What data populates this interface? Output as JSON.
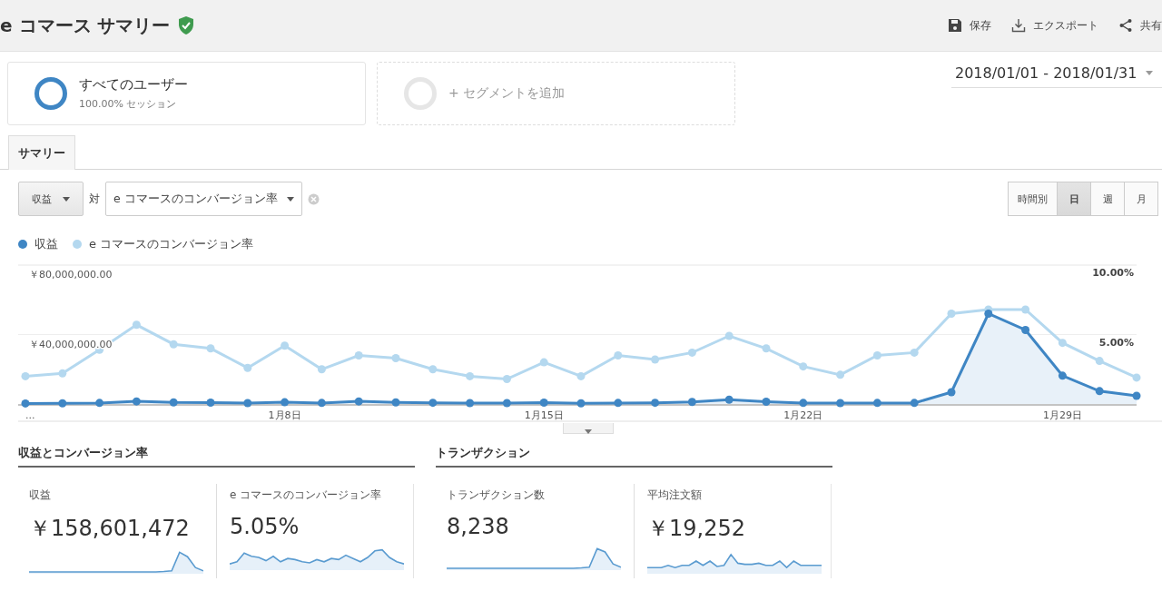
{
  "header": {
    "title": "e コマース サマリー",
    "actions": [
      {
        "kind": "save",
        "label": "保存"
      },
      {
        "kind": "export",
        "label": "エクスポート"
      },
      {
        "kind": "share",
        "label": "共有"
      }
    ]
  },
  "segments": [
    {
      "kind": "active",
      "name": "すべてのユーザー",
      "detail": "100.00% セッション"
    },
    {
      "kind": "add",
      "name": "+ セグメントを追加"
    }
  ],
  "date_range": "2018/01/01 - 2018/01/31",
  "tabs": [
    {
      "label": "サマリー",
      "selected": true
    }
  ],
  "metric_picker": {
    "primary": "収益",
    "versus": "対",
    "secondary": "e コマースのコンバージョン率"
  },
  "periods": [
    {
      "label": "時間別",
      "selected": false
    },
    {
      "label": "日",
      "selected": true
    },
    {
      "label": "週",
      "selected": false
    },
    {
      "label": "月",
      "selected": false
    }
  ],
  "chart": {
    "chart_data": {
      "type": "line",
      "categories": [
        "...",
        null,
        null,
        null,
        null,
        null,
        null,
        "1月8日",
        null,
        null,
        null,
        null,
        null,
        null,
        "1月15日",
        null,
        null,
        null,
        null,
        null,
        null,
        "1月22日",
        null,
        null,
        null,
        null,
        null,
        null,
        "1月29日",
        null,
        null
      ],
      "series": [
        {
          "name": "収益",
          "color": "#3f86c4",
          "marker": "circle",
          "type": "area",
          "axis": "y",
          "values": [
            300000,
            400000,
            600000,
            1500000,
            900000,
            800000,
            500000,
            1000000,
            600000,
            1500000,
            900000,
            700000,
            500000,
            500000,
            800000,
            400000,
            600000,
            700000,
            1200000,
            2500000,
            1300000,
            600000,
            500000,
            600000,
            600000,
            6800000,
            52000000,
            42600000,
            16300000,
            7400000,
            4700000
          ]
        },
        {
          "name": "e コマースのコンバージョン率",
          "color": "#b4d8ef",
          "marker": "circle",
          "axis": "y2",
          "values": [
            2.0,
            2.2,
            3.9,
            5.7,
            4.3,
            4.0,
            2.6,
            4.2,
            2.5,
            3.5,
            3.3,
            2.5,
            2.0,
            1.8,
            3.0,
            2.0,
            3.5,
            3.2,
            3.7,
            4.9,
            4.0,
            2.7,
            2.1,
            3.5,
            3.7,
            6.5,
            6.8,
            6.8,
            4.4,
            3.1,
            1.9
          ]
        }
      ],
      "ylim": [
        0,
        80000000
      ],
      "yticks": [
        {
          "value": 40000000,
          "label": "￥40,000,000.00"
        },
        {
          "value": 80000000,
          "label": "￥80,000,000.00"
        }
      ],
      "y2lim": [
        0,
        10
      ],
      "y2ticks": [
        {
          "value": 5,
          "label": "5.00%"
        },
        {
          "value": 10,
          "label": "10.00%"
        }
      ]
    }
  },
  "sections": [
    {
      "title": "収益とコンバージョン率",
      "metrics": [
        {
          "label": "収益",
          "value": "￥158,601,472"
        },
        {
          "label": "e コマースのコンバージョン率",
          "value": "5.05%"
        }
      ]
    },
    {
      "title": "トランザクション",
      "metrics": [
        {
          "label": "トランザクション数",
          "value": "8,238"
        },
        {
          "label": "平均注文額",
          "value": "￥19,252"
        }
      ]
    }
  ]
}
